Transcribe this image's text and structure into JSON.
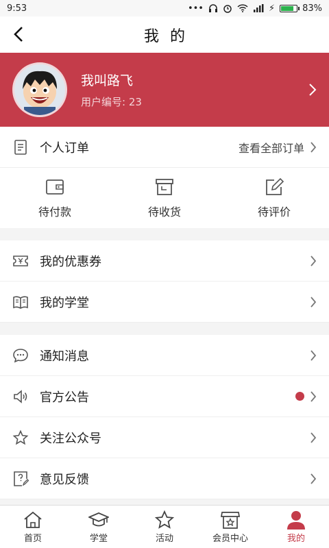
{
  "status_bar": {
    "time": "9:53",
    "battery": "83%",
    "battery_level": 0.83
  },
  "nav": {
    "title": "我的"
  },
  "profile": {
    "name": "我叫路飞",
    "user_id": "用户编号: 23"
  },
  "orders": {
    "title": "个人订单",
    "view_all": "查看全部订单",
    "items": [
      {
        "label": "待付款",
        "icon": "wallet-icon"
      },
      {
        "label": "待收货",
        "icon": "box-icon"
      },
      {
        "label": "待评价",
        "icon": "edit-icon"
      }
    ]
  },
  "menu_group1": [
    {
      "label": "我的优惠券",
      "icon": "coupon-icon"
    },
    {
      "label": "我的学堂",
      "icon": "book-icon"
    }
  ],
  "menu_group2": [
    {
      "label": "通知消息",
      "icon": "message-icon"
    },
    {
      "label": "官方公告",
      "icon": "speaker-icon",
      "has_badge": true
    },
    {
      "label": "关注公众号",
      "icon": "star-icon"
    },
    {
      "label": "意见反馈",
      "icon": "feedback-icon"
    }
  ],
  "tabs": [
    {
      "label": "首页",
      "icon": "home-icon"
    },
    {
      "label": "学堂",
      "icon": "graduation-cap-icon"
    },
    {
      "label": "活动",
      "icon": "star-icon"
    },
    {
      "label": "会员中心",
      "icon": "store-icon"
    },
    {
      "label": "我的",
      "icon": "person-icon",
      "active": true
    }
  ],
  "colors": {
    "accent": "#c43c4a",
    "badge": "#c43c4a"
  }
}
